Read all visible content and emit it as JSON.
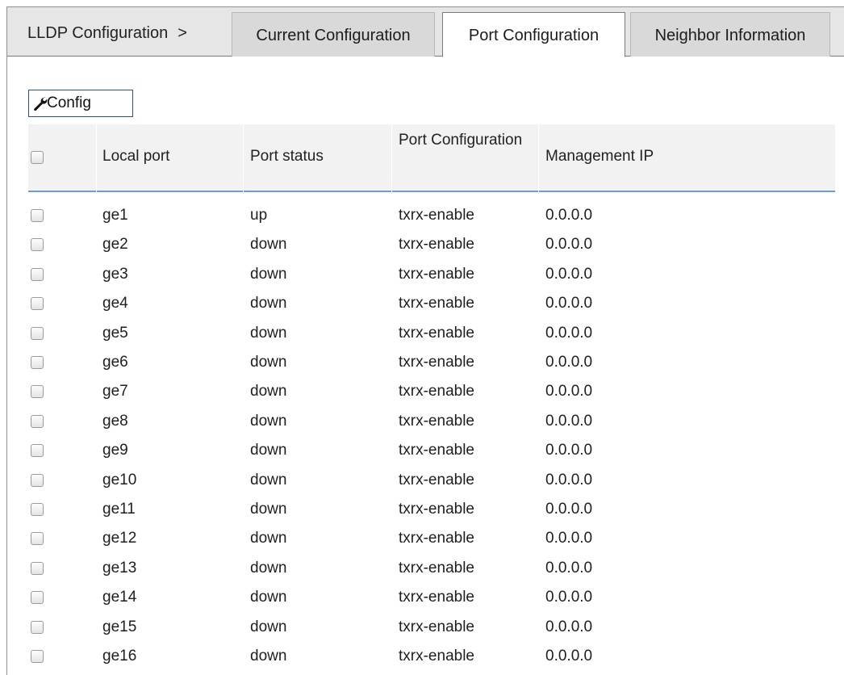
{
  "breadcrumb": {
    "label": "LLDP Configuration",
    "separator": ">"
  },
  "tabs": [
    {
      "label": "Current Configuration",
      "active": false
    },
    {
      "label": "Port Configuration",
      "active": true
    },
    {
      "label": "Neighbor Information",
      "active": false
    }
  ],
  "toolbar": {
    "config_label": "Config",
    "config_icon": "wrench-icon"
  },
  "table": {
    "headers": {
      "local_port": "Local port",
      "port_status": "Port status",
      "port_configuration": "Port Configuration",
      "management_ip": "Management IP"
    },
    "rows": [
      {
        "port": "ge1",
        "status": "up",
        "config": "txrx-enable",
        "ip": "0.0.0.0"
      },
      {
        "port": "ge2",
        "status": "down",
        "config": "txrx-enable",
        "ip": "0.0.0.0"
      },
      {
        "port": "ge3",
        "status": "down",
        "config": "txrx-enable",
        "ip": "0.0.0.0"
      },
      {
        "port": "ge4",
        "status": "down",
        "config": "txrx-enable",
        "ip": "0.0.0.0"
      },
      {
        "port": "ge5",
        "status": "down",
        "config": "txrx-enable",
        "ip": "0.0.0.0"
      },
      {
        "port": "ge6",
        "status": "down",
        "config": "txrx-enable",
        "ip": "0.0.0.0"
      },
      {
        "port": "ge7",
        "status": "down",
        "config": "txrx-enable",
        "ip": "0.0.0.0"
      },
      {
        "port": "ge8",
        "status": "down",
        "config": "txrx-enable",
        "ip": "0.0.0.0"
      },
      {
        "port": "ge9",
        "status": "down",
        "config": "txrx-enable",
        "ip": "0.0.0.0"
      },
      {
        "port": "ge10",
        "status": "down",
        "config": "txrx-enable",
        "ip": "0.0.0.0"
      },
      {
        "port": "ge11",
        "status": "down",
        "config": "txrx-enable",
        "ip": "0.0.0.0"
      },
      {
        "port": "ge12",
        "status": "down",
        "config": "txrx-enable",
        "ip": "0.0.0.0"
      },
      {
        "port": "ge13",
        "status": "down",
        "config": "txrx-enable",
        "ip": "0.0.0.0"
      },
      {
        "port": "ge14",
        "status": "down",
        "config": "txrx-enable",
        "ip": "0.0.0.0"
      },
      {
        "port": "ge15",
        "status": "down",
        "config": "txrx-enable",
        "ip": "0.0.0.0"
      },
      {
        "port": "ge16",
        "status": "down",
        "config": "txrx-enable",
        "ip": "0.0.0.0"
      }
    ]
  },
  "colors": {
    "header_underline": "#6a9fd4",
    "button_border": "#2b4f8a",
    "tabbar_bg": "#e6e6e6"
  }
}
